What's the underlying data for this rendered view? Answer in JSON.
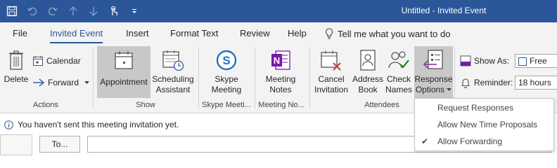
{
  "window": {
    "title": "Untitled  -  Invited Event",
    "accent": "#2b579a"
  },
  "qat": {
    "icons": [
      "save-icon",
      "undo-icon",
      "redo-icon",
      "up-arrow-icon",
      "down-arrow-icon",
      "touch-mode-icon",
      "customize-qat-icon"
    ]
  },
  "tabs": [
    {
      "label": "File"
    },
    {
      "label": "Invited Event",
      "active": true
    },
    {
      "label": "Insert"
    },
    {
      "label": "Format Text"
    },
    {
      "label": "Review"
    },
    {
      "label": "Help"
    }
  ],
  "tellme": {
    "text": "Tell me what you want to do"
  },
  "ribbon": {
    "actions": {
      "label": "Actions",
      "delete": "Delete",
      "calendar": "Calendar",
      "forward": "Forward"
    },
    "show": {
      "label": "Show",
      "appointment": "Appointment",
      "scheduling_line1": "Scheduling",
      "scheduling_line2": "Assistant"
    },
    "skype": {
      "label": "Skype Meeti...",
      "line1": "Skype",
      "line2": "Meeting"
    },
    "notes": {
      "label": "Meeting No...",
      "line1": "Meeting",
      "line2": "Notes"
    },
    "attendees": {
      "label": "Attendees",
      "cancel_line1": "Cancel",
      "cancel_line2": "Invitation",
      "address_line1": "Address",
      "address_line2": "Book",
      "check_line1": "Check",
      "check_line2": "Names",
      "response_line1": "Response",
      "response_line2": "Options"
    },
    "options": {
      "show_as_label": "Show As:",
      "show_as_value": "Free",
      "reminder_label": "Reminder:",
      "reminder_value": "18 hours"
    }
  },
  "infobar": {
    "message": "You haven't sent this meeting invitation yet."
  },
  "compose": {
    "to_label": "To..."
  },
  "dropdown": {
    "items": [
      {
        "label": "Request Responses",
        "checked": false
      },
      {
        "label": "Allow New Time Proposals",
        "checked": false
      },
      {
        "label": "Allow Forwarding",
        "checked": true
      }
    ],
    "check_glyph": "✔"
  }
}
